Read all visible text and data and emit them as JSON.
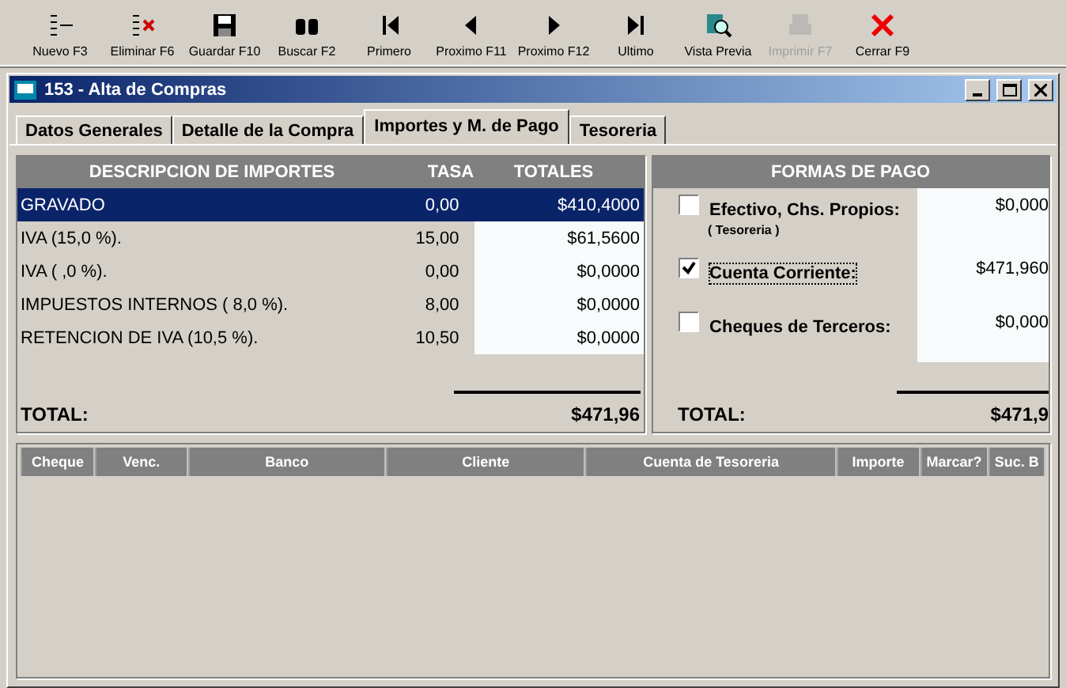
{
  "toolbar": [
    {
      "label": "Nuevo F3",
      "disabled": false
    },
    {
      "label": "Eliminar F6",
      "disabled": false
    },
    {
      "label": "Guardar F10",
      "disabled": false
    },
    {
      "label": "Buscar F2",
      "disabled": false
    },
    {
      "label": "Primero",
      "disabled": false
    },
    {
      "label": "Proximo F11",
      "disabled": false
    },
    {
      "label": "Proximo F12",
      "disabled": false
    },
    {
      "label": "Ultimo",
      "disabled": false
    },
    {
      "label": "Vista Previa",
      "disabled": false
    },
    {
      "label": "Imprimir F7",
      "disabled": true
    },
    {
      "label": "Cerrar F9",
      "disabled": false
    }
  ],
  "window": {
    "title": "153 - Alta de Compras"
  },
  "tabs": [
    {
      "label": "Datos Generales",
      "selected": false
    },
    {
      "label": "Detalle de la Compra",
      "selected": false
    },
    {
      "label": "Importes y M. de Pago",
      "selected": true
    },
    {
      "label": "Tesoreria",
      "selected": false
    }
  ],
  "importes": {
    "columns": [
      "DESCRIPCION DE IMPORTES",
      "TASA",
      "TOTALES"
    ],
    "rows": [
      {
        "descripcion": "GRAVADO",
        "tasa": "0,00",
        "total": "$410,4000",
        "selected": true
      },
      {
        "descripcion": "IVA  (15,0 %).",
        "tasa": "15,00",
        "total": "$61,5600",
        "selected": false
      },
      {
        "descripcion": "IVA  ( ,0 %).",
        "tasa": "0,00",
        "total": "$0,0000",
        "selected": false
      },
      {
        "descripcion": "IMPUESTOS INTERNOS  ( 8,0 %).",
        "tasa": "8,00",
        "total": "$0,0000",
        "selected": false
      },
      {
        "descripcion": "RETENCION DE IVA  (10,5 %).",
        "tasa": "10,50",
        "total": "$0,0000",
        "selected": false
      }
    ],
    "total_label": "TOTAL:",
    "total": "$471,96"
  },
  "formas_de_pago": {
    "title": "FORMAS DE PAGO",
    "items": [
      {
        "label": "Efectivo, Chs. Propios:",
        "note": "( Tesoreria )",
        "amount": "$0,000",
        "checked": false
      },
      {
        "label": "Cuenta Corriente:",
        "amount": "$471,960",
        "checked": true
      },
      {
        "label": "Cheques de Terceros:",
        "amount": "$0,000",
        "checked": false
      }
    ],
    "total_label": "TOTAL:",
    "total": "$471,9"
  },
  "cheques": {
    "columns": [
      "Cheque",
      "Venc.",
      "Banco",
      "Cliente",
      "Cuenta de Tesoreria",
      "Importe",
      "Marcar?",
      "Suc. B"
    ]
  }
}
